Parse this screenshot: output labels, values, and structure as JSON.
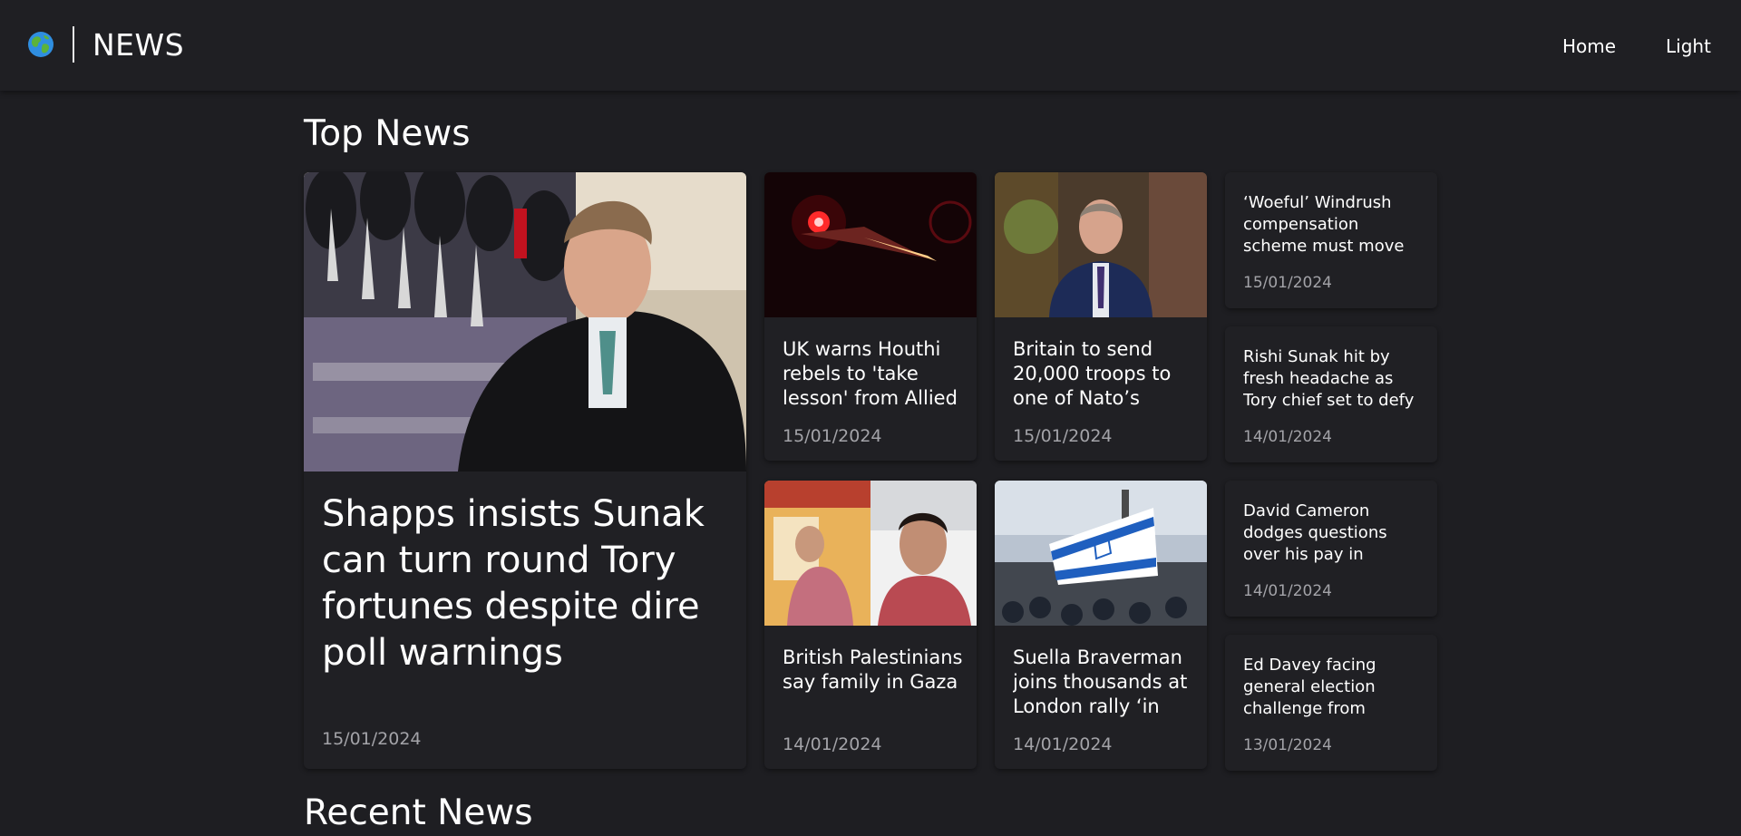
{
  "nav": {
    "brand": "NEWS",
    "links": [
      "Home",
      "Light"
    ]
  },
  "sections": {
    "top": "Top News",
    "recent": "Recent News"
  },
  "featured": {
    "headline": "Shapps insists Sunak can turn round Tory fortunes despite dire poll warnings",
    "date": "15/01/2024"
  },
  "grid": [
    {
      "headline": "UK warns Houthi rebels to 'take lesson' from Allied",
      "date": "15/01/2024"
    },
    {
      "headline": "Britain to send 20,000 troops to one of Nato’s",
      "date": "15/01/2024"
    },
    {
      "headline": "British Palestinians say family in Gaza",
      "date": "14/01/2024"
    },
    {
      "headline": "Suella Braverman joins thousands at London rally ‘in",
      "date": "14/01/2024"
    }
  ],
  "side": [
    {
      "headline": "‘Woeful’ Windrush compensation scheme must move",
      "date": "15/01/2024"
    },
    {
      "headline": "Rishi Sunak hit by fresh headache as Tory chief set to defy",
      "date": "14/01/2024"
    },
    {
      "headline": "David Cameron dodges questions over his pay in",
      "date": "14/01/2024"
    },
    {
      "headline": "Ed Davey facing general election challenge from",
      "date": "13/01/2024"
    }
  ],
  "icons": {
    "logo": "globe-icon"
  },
  "colors": {
    "background": "#1e1e22",
    "card": "#202024",
    "date": "#a3a3a8"
  }
}
